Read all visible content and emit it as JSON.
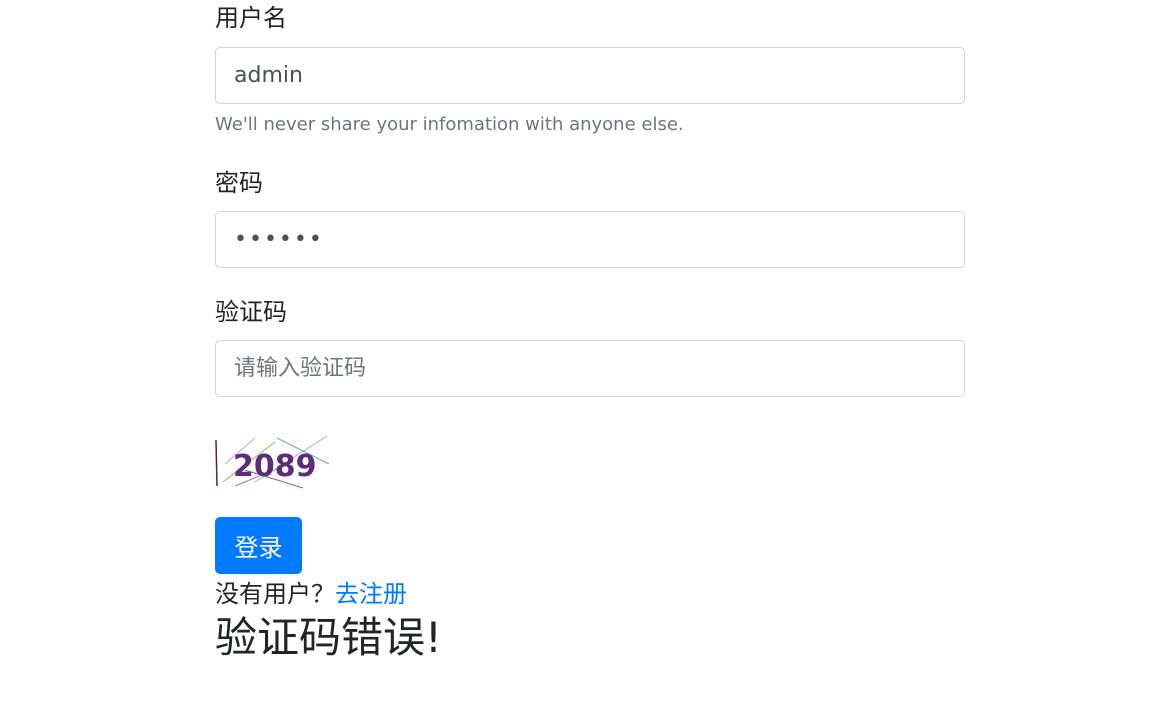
{
  "username": {
    "label": "用户名",
    "value": "admin",
    "help": "We'll never share your infomation with anyone else."
  },
  "password": {
    "label": "密码",
    "value": "••••••"
  },
  "captcha": {
    "label": "验证码",
    "placeholder": "请输入验证码",
    "image_text": "2089"
  },
  "login_button": "登录",
  "signup": {
    "prompt": "没有用户？",
    "link": "去注册"
  },
  "error_message": "验证码错误!",
  "colors": {
    "primary": "#007bff",
    "text": "#212529",
    "muted": "#6c757d",
    "border": "#ced4da"
  }
}
